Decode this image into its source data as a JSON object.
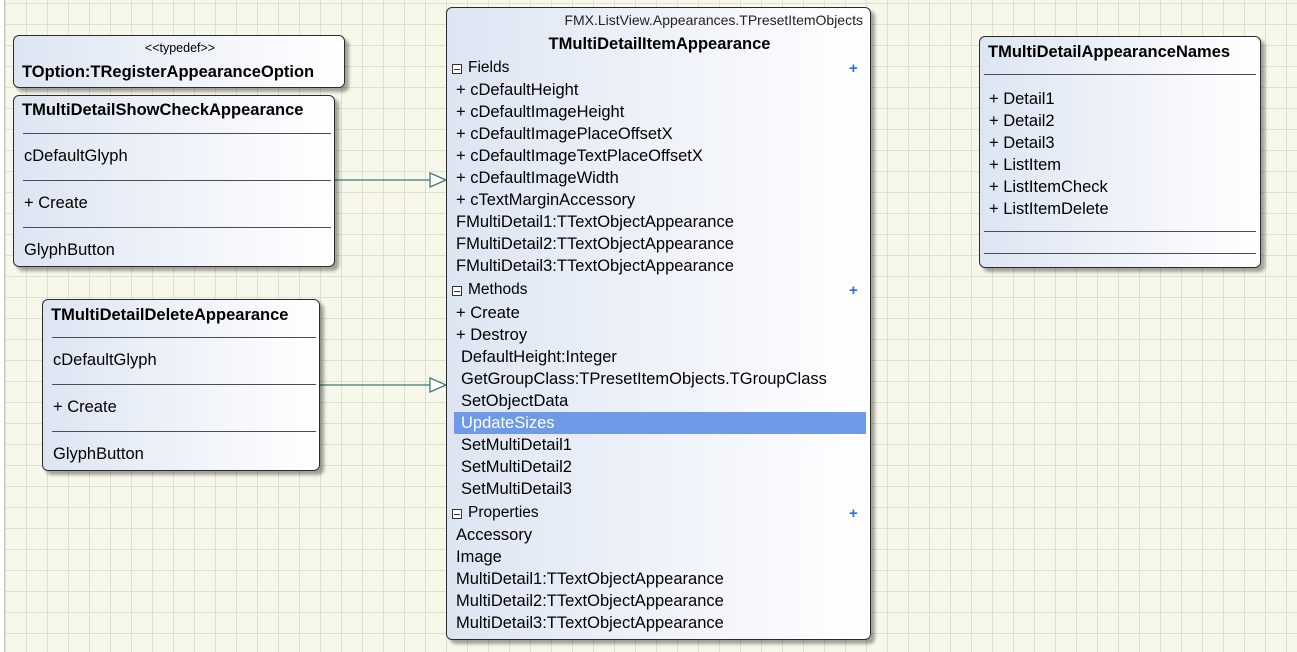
{
  "typedef_box": {
    "stereotype": "<<typedef>>",
    "name": "TOption:TRegisterAppearanceOption"
  },
  "show_check_class": {
    "name": "TMultiDetailShowCheckAppearance",
    "fields": [
      "cDefaultGlyph"
    ],
    "methods": [
      "+  Create"
    ],
    "properties": [
      "GlyphButton"
    ]
  },
  "delete_class": {
    "name": "TMultiDetailDeleteAppearance",
    "fields": [
      "cDefaultGlyph"
    ],
    "methods": [
      "+  Create"
    ],
    "properties": [
      "GlyphButton"
    ]
  },
  "main_class": {
    "namespace": "FMX.ListView.Appearances.TPresetItemObjects",
    "name": "TMultiDetailItemAppearance",
    "sections": {
      "fields_label": "Fields",
      "methods_label": "Methods",
      "properties_label": "Properties"
    },
    "fields": [
      "+ cDefaultHeight",
      "+ cDefaultImageHeight",
      "+ cDefaultImagePlaceOffsetX",
      "+ cDefaultImageTextPlaceOffsetX",
      "+ cDefaultImageWidth",
      "+ cTextMarginAccessory",
      "FMultiDetail1:TTextObjectAppearance",
      "FMultiDetail2:TTextObjectAppearance",
      "FMultiDetail3:TTextObjectAppearance"
    ],
    "methods": [
      "+  Create",
      "+  Destroy",
      "DefaultHeight:Integer",
      "GetGroupClass:TPresetItemObjects.TGroupClass",
      "SetObjectData",
      "UpdateSizes",
      "SetMultiDetail1",
      "SetMultiDetail2",
      "SetMultiDetail3"
    ],
    "selected_method": "UpdateSizes",
    "properties": [
      "Accessory",
      "Image",
      "MultiDetail1:TTextObjectAppearance",
      "MultiDetail2:TTextObjectAppearance",
      "MultiDetail3:TTextObjectAppearance"
    ]
  },
  "names_class": {
    "name": "TMultiDetailAppearanceNames",
    "items": [
      "+ Detail1",
      "+ Detail2",
      "+ Detail3",
      "+ ListItem",
      "+ ListItemCheck",
      "+ ListItemDelete"
    ]
  },
  "colors": {
    "selection": "#6e9ae8",
    "connector": "#3f7a78",
    "expand_plus": "#2b6fd4"
  },
  "icons": {
    "collapse": "collapse-box-icon",
    "add": "plus-icon",
    "arrowhead": "open-triangle-arrowhead"
  }
}
